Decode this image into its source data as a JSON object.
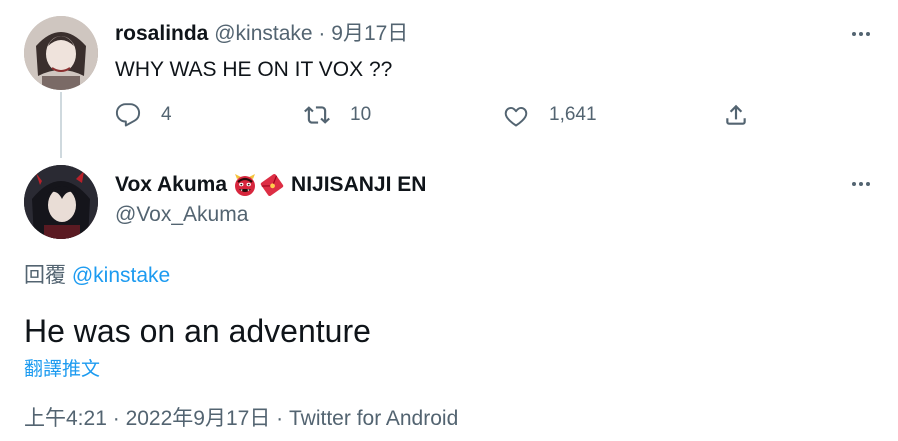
{
  "parent_tweet": {
    "display_name": "rosalinda",
    "handle": "@kinstake",
    "separator": "·",
    "date": "9月17日",
    "text": "WHY WAS HE ON IT VOX ??",
    "actions": {
      "reply_count": "4",
      "retweet_count": "10",
      "like_count": "1,641"
    }
  },
  "main_tweet": {
    "display_name": "Vox Akuma",
    "affiliation": "NIJISANJI EN",
    "handle": "@Vox_Akuma",
    "reply_prefix": "回覆",
    "reply_mention": "@kinstake",
    "text": "He was on an adventure",
    "translate_label": "翻譯推文",
    "timestamp": "上午4:21",
    "separator1": "·",
    "date": "2022年9月17日",
    "separator2": "·",
    "source": "Twitter for Android"
  },
  "icons": {
    "more": "more-horizontal-icon",
    "reply": "reply-icon",
    "retweet": "retweet-icon",
    "like": "heart-icon",
    "share": "share-icon",
    "oni_emoji": "japanese-ogre-emoji",
    "envelope_emoji": "red-envelope-emoji"
  },
  "colors": {
    "text_primary": "#0f1419",
    "text_secondary": "#536471",
    "link": "#1d9bf0",
    "thread_line": "#cfd9de"
  }
}
